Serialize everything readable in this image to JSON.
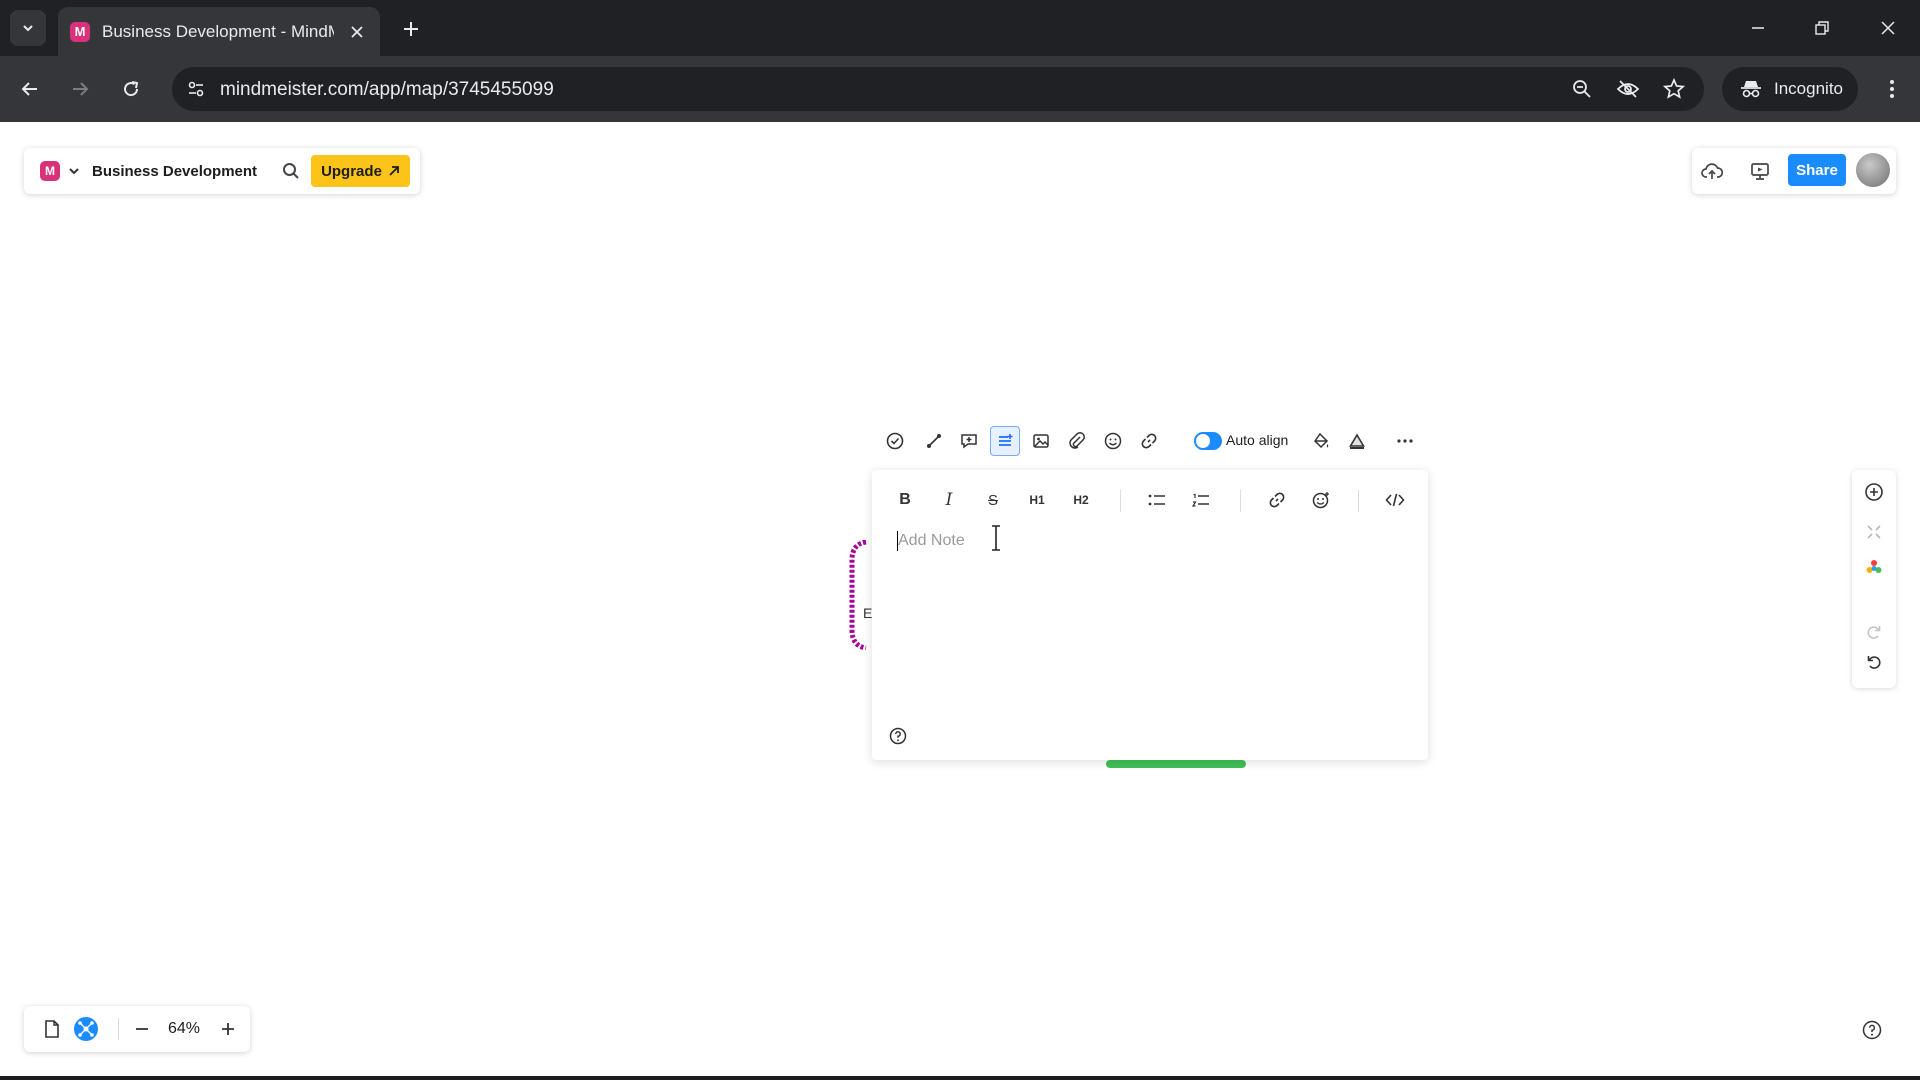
{
  "browser": {
    "tab_title": "Business Development - MindMeister",
    "favicon_letter": "M",
    "url": "mindmeister.com/app/map/3745455099",
    "incognito_label": "Incognito"
  },
  "header": {
    "logo_letter": "M",
    "map_name": "Business Development",
    "upgrade_label": "Upgrade",
    "share_label": "Share"
  },
  "floating_toolbar": {
    "auto_align_label": "Auto align",
    "auto_align_on": true
  },
  "note_editor": {
    "format_buttons": {
      "bold": "B",
      "italic": "I",
      "strike": "S",
      "h1": "H1",
      "h2": "H2"
    },
    "placeholder": "Add Note",
    "value": ""
  },
  "zoom": {
    "level": "64%"
  },
  "colors": {
    "accent": "#1a8cff",
    "upgrade": "#fcc419",
    "brand": "#d9317a",
    "node_left": "#a3059b",
    "node_bottom": "#40c057"
  }
}
